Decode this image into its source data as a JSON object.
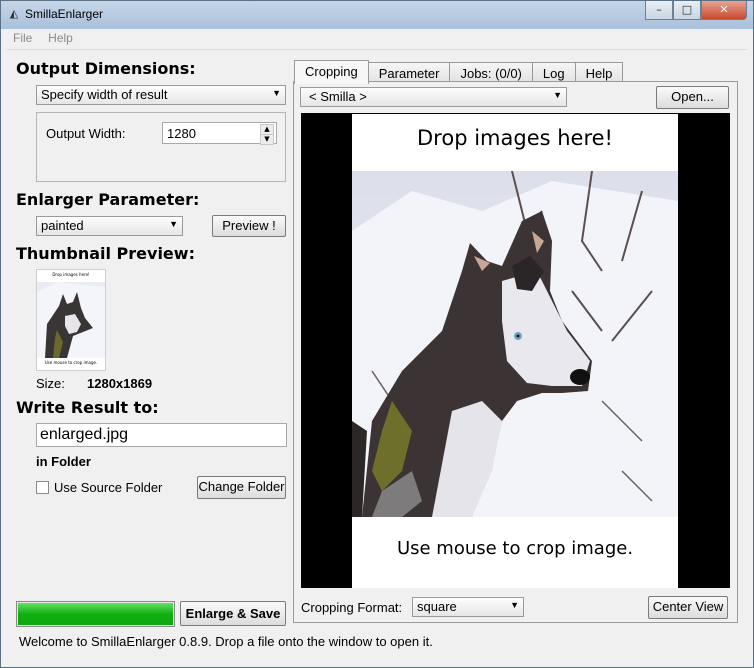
{
  "window": {
    "title": "SmillaEnlarger"
  },
  "menu": [
    "File",
    "Help"
  ],
  "output_dimensions": {
    "heading": "Output Dimensions:",
    "mode": "Specify width of result",
    "width_label": "Output Width:",
    "width_value": "1280"
  },
  "enlarger": {
    "heading": "Enlarger Parameter:",
    "preset": "painted",
    "preview_button": "Preview !"
  },
  "thumbnail": {
    "heading": "Thumbnail Preview:",
    "top_text": "Drop images here!",
    "bottom_text": "Use mouse to crop image.",
    "size_label": "Size:",
    "size_value": "1280x1869"
  },
  "write_result": {
    "heading": "Write Result to:",
    "filename": "enlarged.jpg",
    "folder_label": "in Folder",
    "use_source_label": "Use Source Folder",
    "use_source_checked": false,
    "change_folder_button": "Change Folder"
  },
  "progress": {
    "value": 1.0
  },
  "enlarge_button": "Enlarge & Save",
  "tabs": [
    "Cropping",
    "Parameter",
    "Jobs: (0/0)",
    "Log",
    "Help"
  ],
  "active_tab": "Cropping",
  "cropping": {
    "image_select": "< Smilla >",
    "open_button": "Open...",
    "drop_text": "Drop images here!",
    "crop_hint": "Use mouse to crop image.",
    "format_label": "Cropping Format:",
    "format_value": "square",
    "center_button": "Center View"
  },
  "status": "Welcome to SmillaEnlarger 0.8.9.  Drop a file onto the window to open it.",
  "colors": {
    "progress": "#18c218",
    "title_bar": "#b8cbe0",
    "close_button": "#c84a2e"
  }
}
